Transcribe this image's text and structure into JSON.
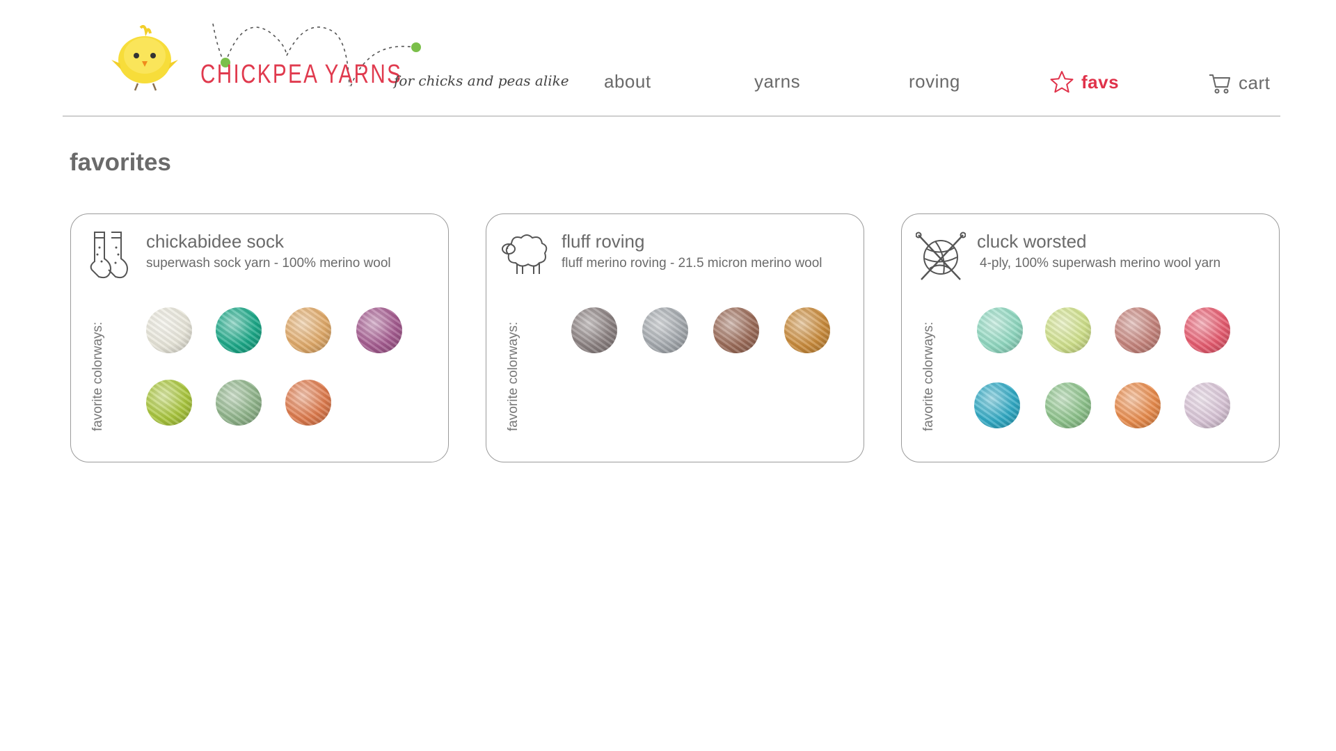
{
  "header": {
    "brand": "CHICKPEA YARNS",
    "tagline": "for chicks and peas alike",
    "nav": [
      {
        "label": "about",
        "icon": null
      },
      {
        "label": "yarns",
        "icon": null
      },
      {
        "label": "roving",
        "icon": null
      },
      {
        "label": "favs",
        "icon": "star-icon",
        "active": true
      },
      {
        "label": "cart",
        "icon": "cart-icon"
      }
    ]
  },
  "accent_color": "#e0324a",
  "page_title": "favorites",
  "cards": [
    {
      "title": "chickabidee sock",
      "subtitle": "superwash sock yarn - 100% merino wool",
      "icon": "socks-icon",
      "fav_label": "favorite colorways:",
      "swatches": [
        "#e8e6da",
        "#1aa887",
        "#e0a968",
        "#a45a8f",
        "#a9c63c",
        "#8fb48a",
        "#de7a4c"
      ]
    },
    {
      "title": "fluff roving",
      "subtitle": "fluff merino roving - 21.5 micron merino wool",
      "icon": "sheep-icon",
      "fav_label": "favorite colorways:",
      "swatches": [
        "#8a8080",
        "#a3a8ad",
        "#9a6a57",
        "#c98a3a"
      ]
    },
    {
      "title": "cluck worsted",
      "subtitle": "4-ply, 100% superwash merino wool yarn",
      "icon": "yarn-ball-icon",
      "fav_label": "favorite colorways:",
      "swatches": [
        "#8fd8c0",
        "#cfe08a",
        "#c4827a",
        "#e65a6e",
        "#2fa9c4",
        "#8cc28a",
        "#e88a4a",
        "#d8c4d6"
      ]
    }
  ]
}
